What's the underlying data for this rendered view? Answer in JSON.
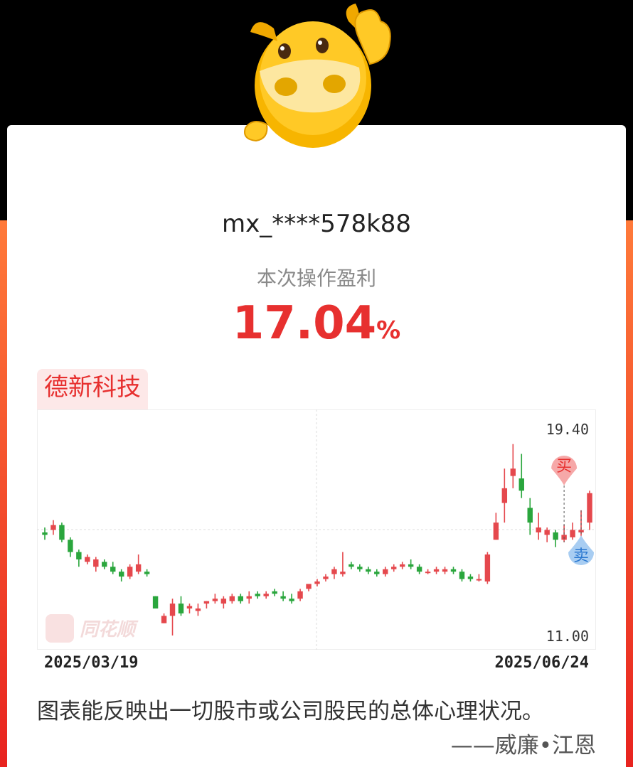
{
  "user": {
    "name": "mx_****578k88"
  },
  "profit": {
    "label": "本次操作盈利",
    "value": "17.04",
    "unit": "%"
  },
  "stock": {
    "name": "德新科技"
  },
  "chart_data": {
    "type": "candlestick",
    "ymax_label": "19.40",
    "ymin_label": "11.00",
    "ylim": [
      11.0,
      19.4
    ],
    "x_start": "2025/03/19",
    "x_end": "2025/06/24",
    "watermark": "同花顺",
    "markers": [
      {
        "type": "buy",
        "label": "买",
        "index": 61
      },
      {
        "type": "sell",
        "label": "卖",
        "index": 63
      }
    ],
    "candles": [
      [
        15.2,
        15.4,
        14.9,
        15.1
      ],
      [
        15.3,
        15.7,
        15.1,
        15.5
      ],
      [
        15.5,
        15.6,
        14.8,
        14.9
      ],
      [
        14.9,
        15.0,
        14.2,
        14.4
      ],
      [
        14.4,
        14.5,
        13.8,
        14.1
      ],
      [
        14.0,
        14.3,
        13.9,
        14.2
      ],
      [
        13.8,
        14.2,
        13.6,
        14.1
      ],
      [
        14.0,
        14.1,
        13.7,
        13.8
      ],
      [
        13.8,
        14.0,
        13.5,
        13.6
      ],
      [
        13.6,
        13.7,
        13.2,
        13.4
      ],
      [
        13.4,
        13.9,
        13.3,
        13.8
      ],
      [
        13.6,
        14.3,
        13.5,
        13.9
      ],
      [
        13.6,
        13.7,
        13.4,
        13.5
      ],
      [
        12.6,
        12.6,
        12.2,
        12.1
      ],
      [
        11.5,
        11.9,
        11.5,
        11.8
      ],
      [
        11.8,
        12.5,
        11.0,
        12.3
      ],
      [
        12.3,
        12.6,
        11.8,
        11.9
      ],
      [
        12.1,
        12.3,
        11.9,
        12.2
      ],
      [
        12.0,
        12.3,
        11.8,
        12.1
      ],
      [
        12.3,
        12.4,
        12.1,
        12.4
      ],
      [
        12.4,
        12.7,
        12.3,
        12.5
      ],
      [
        12.3,
        12.6,
        12.1,
        12.5
      ],
      [
        12.4,
        12.7,
        12.3,
        12.6
      ],
      [
        12.6,
        12.7,
        12.3,
        12.4
      ],
      [
        12.5,
        12.8,
        12.3,
        12.6
      ],
      [
        12.7,
        12.8,
        12.5,
        12.6
      ],
      [
        12.6,
        12.8,
        12.5,
        12.7
      ],
      [
        12.8,
        12.9,
        12.6,
        12.7
      ],
      [
        12.6,
        12.8,
        12.4,
        12.5
      ],
      [
        12.5,
        12.7,
        12.3,
        12.4
      ],
      [
        12.5,
        12.9,
        12.4,
        12.8
      ],
      [
        12.9,
        13.1,
        12.8,
        13.1
      ],
      [
        13.1,
        13.3,
        13.0,
        13.2
      ],
      [
        13.3,
        13.5,
        13.2,
        13.4
      ],
      [
        13.5,
        13.8,
        13.3,
        13.7
      ],
      [
        13.5,
        14.4,
        13.4,
        13.6
      ],
      [
        13.9,
        14.0,
        13.7,
        13.8
      ],
      [
        13.8,
        13.9,
        13.6,
        13.7
      ],
      [
        13.7,
        13.8,
        13.5,
        13.6
      ],
      [
        13.6,
        13.7,
        13.4,
        13.5
      ],
      [
        13.5,
        13.8,
        13.4,
        13.7
      ],
      [
        13.7,
        13.9,
        13.6,
        13.8
      ],
      [
        13.8,
        14.0,
        13.7,
        13.9
      ],
      [
        13.9,
        14.1,
        13.7,
        13.8
      ],
      [
        13.8,
        13.9,
        13.5,
        13.6
      ],
      [
        13.6,
        13.7,
        13.5,
        13.6
      ],
      [
        13.6,
        13.8,
        13.5,
        13.7
      ],
      [
        13.6,
        13.8,
        13.5,
        13.7
      ],
      [
        13.7,
        13.8,
        13.5,
        13.6
      ],
      [
        13.6,
        13.7,
        13.2,
        13.3
      ],
      [
        13.4,
        13.5,
        13.2,
        13.3
      ],
      [
        13.3,
        13.5,
        13.2,
        13.3
      ],
      [
        13.2,
        14.4,
        13.1,
        14.3
      ],
      [
        14.9,
        16.0,
        14.9,
        15.6
      ],
      [
        16.4,
        17.8,
        15.6,
        17.0
      ],
      [
        17.5,
        18.8,
        17.0,
        17.8
      ],
      [
        17.4,
        18.4,
        16.6,
        16.9
      ],
      [
        16.2,
        16.6,
        15.1,
        15.6
      ],
      [
        15.2,
        16.0,
        14.9,
        15.4
      ],
      [
        15.1,
        15.4,
        14.8,
        15.3
      ],
      [
        15.2,
        15.3,
        14.6,
        14.9
      ],
      [
        14.9,
        15.5,
        14.8,
        15.1
      ],
      [
        15.0,
        15.6,
        14.9,
        15.3
      ],
      [
        15.2,
        16.1,
        14.9,
        15.3
      ],
      [
        15.6,
        16.9,
        15.3,
        16.8
      ]
    ]
  }
}
